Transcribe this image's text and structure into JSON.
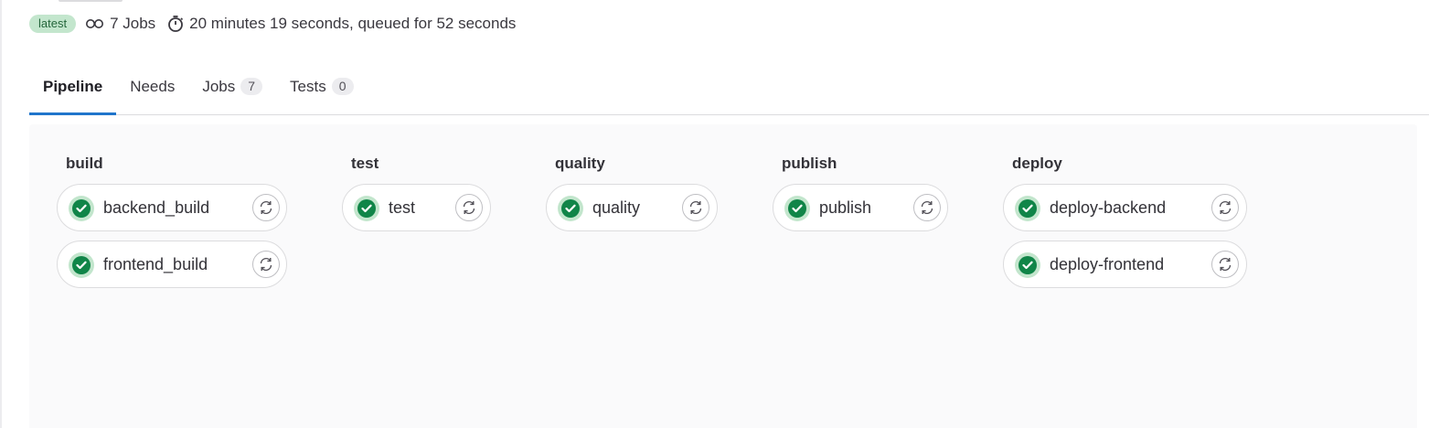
{
  "meta": {
    "badge": "latest",
    "jobs_text": "7 Jobs",
    "duration_text": "20 minutes 19 seconds, queued for 52 seconds"
  },
  "tabs": [
    {
      "label": "Pipeline",
      "active": true
    },
    {
      "label": "Needs"
    },
    {
      "label": "Jobs",
      "count": "7"
    },
    {
      "label": "Tests",
      "count": "0"
    }
  ],
  "stages": [
    {
      "name": "build",
      "jobs": [
        {
          "name": "backend_build",
          "status": "passed"
        },
        {
          "name": "frontend_build",
          "status": "passed"
        }
      ]
    },
    {
      "name": "test",
      "jobs": [
        {
          "name": "test",
          "status": "passed"
        }
      ]
    },
    {
      "name": "quality",
      "jobs": [
        {
          "name": "quality",
          "status": "passed"
        }
      ]
    },
    {
      "name": "publish",
      "jobs": [
        {
          "name": "publish",
          "status": "passed"
        }
      ]
    },
    {
      "name": "deploy",
      "jobs": [
        {
          "name": "deploy-backend",
          "status": "passed"
        },
        {
          "name": "deploy-frontend",
          "status": "passed"
        }
      ]
    }
  ],
  "colors": {
    "success": "#108548",
    "success_bg": "#c3e6cd",
    "tab_active": "#1f75cb"
  },
  "icons": {
    "jobs": "pipeline-link-icon",
    "duration": "timer-icon",
    "status": "check-circle-icon",
    "retry": "retry-icon"
  }
}
